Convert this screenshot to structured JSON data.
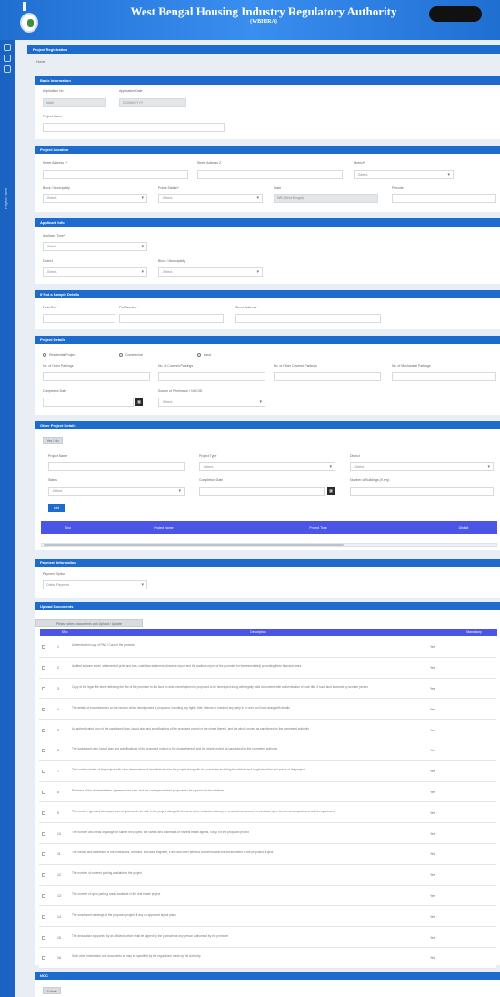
{
  "header": {
    "title": "West Bengal Housing Industry Regulatory Authority",
    "subtitle": "(WBHIRA)"
  },
  "left_rail": {
    "label": "Project Form"
  },
  "page": {
    "title_bar": "Project Registration",
    "breadcrumb": "Home"
  },
  "basic_information": {
    "title": "Basic Information",
    "application_no_label": "Application No",
    "application_no_value": "####",
    "application_date_label": "Application Date",
    "application_date_value": "DD/MM/YYYY",
    "project_name_label": "Project Name*"
  },
  "project_location": {
    "title": "Project Location",
    "address1_label": "Street Address 1*",
    "address2_label": "Street Address 2",
    "district_label": "District*",
    "district_value": "-Select-",
    "block_label": "Block / Municipality",
    "block_value": "-Select-",
    "police_station_label": "Police Station*",
    "police_station_value": "-Select-",
    "state_label": "State",
    "state_value": "WB (West Bengal)",
    "pincode_label": "Pincode"
  },
  "applicant_info": {
    "title": "Applicant Info",
    "applicant_type_label": "Applicant Type*",
    "applicant_type_value": "-Select-",
    "district_label": "District",
    "district_value": "-Select-",
    "block_label": "Block / Municipality",
    "block_value": "-Select-"
  },
  "if_not_same": {
    "title": "If Not a Sample Details",
    "field1_label": "Field One *",
    "field2_label": "Plot Number *",
    "field3_label": "Street Address *"
  },
  "project_details": {
    "title": "Project Details",
    "radio1": "Residential Project",
    "radio2": "Commercial",
    "radio3": "Land",
    "col1": "No. of Open Parkings",
    "col2": "No. of Covered Parkings",
    "col3": "No. of Other Covered Parkings",
    "col4": "No. of Mechanical Parkings",
    "completion_label": "Completion Date",
    "permission_label": "Source of Permission / NOC/ID",
    "permission_value": "-Select-"
  },
  "other_project": {
    "title": "Other Project Details",
    "toggle_label": "Yes / No",
    "name_label": "Project Name",
    "type_label": "Project Type",
    "type_value": "-Select-",
    "district_label": "District",
    "district_value": "-Select-",
    "status_label": "Status",
    "status_value": "-Select-",
    "completion_label": "Completion Date",
    "buildings_label": "Number of Buildings (If any)",
    "add_button": "Add",
    "table_headers": [
      "Sno",
      "Project Name",
      "Project Type",
      "District"
    ]
  },
  "payment_info": {
    "title": "Payment Information",
    "mode_label": "Payment Option",
    "mode_value": "Online Payment"
  },
  "upload_documents": {
    "title": "Upload Documents",
    "instruction": "Please select documents and Upload / Update",
    "headers": [
      "SNo",
      "Description",
      "Mandatory"
    ],
    "rows": [
      {
        "sn": "1",
        "desc": "Authenticated copy of PAN / Card of the promoter",
        "req": "Yes"
      },
      {
        "sn": "2",
        "desc": "Audited balance sheet, statement of profit and loss, cash flow statement, directors report and the auditors report of the promoter for the immediately preceding three financial years",
        "req": "Yes"
      },
      {
        "sn": "3",
        "desc": "Copy of the legal title deed reflecting the title of the promoter to the land on which development is proposed to be developed along with legally valid documents with authentication of such title, if such land is owned by another person",
        "req": "Yes"
      },
      {
        "sn": "4",
        "desc": "The details of encumbrances on the land on which development is proposed, including any rights, title, interest or name of any party in or over such land along with details",
        "req": "Yes"
      },
      {
        "sn": "5",
        "desc": "An authenticated copy of the sanctioned plan, layout plan and specifications of the proposed project or the phase thereof, and the whole project as sanctioned by the competent authority",
        "req": "Yes"
      },
      {
        "sn": "6",
        "desc": "The sanctioned plan, layout plan and specifications of the proposed project or the phase thereof, and the whole project as sanctioned by the competent authority",
        "req": "Yes"
      },
      {
        "sn": "7",
        "desc": "The location details of the project, with clear demarcation of land dedicated for the project along with its boundaries including the latitude and longitude of the end points of the project",
        "req": "Yes"
      },
      {
        "sn": "8",
        "desc": "Proforma of the allotment letter, agreement for sale, and the conveyance deed proposed to be signed with the allottees",
        "req": "Yes"
      },
      {
        "sn": "9",
        "desc": "The number, type and the carpet area of apartments for sale in the project along with the area of the exclusive balcony or verandah areas and the exclusive open terrace areas apartment with the apartment",
        "req": "Yes"
      },
      {
        "sn": "10",
        "desc": "The number and areas of garage for sale in the project, the names and addresses of his real estate agents, if any, for the proposed project",
        "req": "Yes"
      },
      {
        "sn": "11",
        "desc": "The names and addresses of the contractors, architect, structural engineer, if any and other persons concerned with the development of the proposed project",
        "req": "Yes"
      },
      {
        "sn": "12",
        "desc": "The number of covered parking available in the project",
        "req": "Yes"
      },
      {
        "sn": "13",
        "desc": "The number of open parking areas available in the real estate project",
        "req": "Yes"
      },
      {
        "sn": "14",
        "desc": "The sanctioned drawings of the proposed project, if any on approved layout plans",
        "req": "Yes"
      },
      {
        "sn": "15",
        "desc": "The declaration supported by an affidavit, which shall be signed by the promoter or any person authorised by the promoter",
        "req": "Yes"
      },
      {
        "sn": "16",
        "desc": "Such other information and documents as may be specified by the regulations made by the Authority",
        "req": "Yes"
      }
    ]
  },
  "footer_section": {
    "title": "NOC",
    "button": "Submit"
  }
}
